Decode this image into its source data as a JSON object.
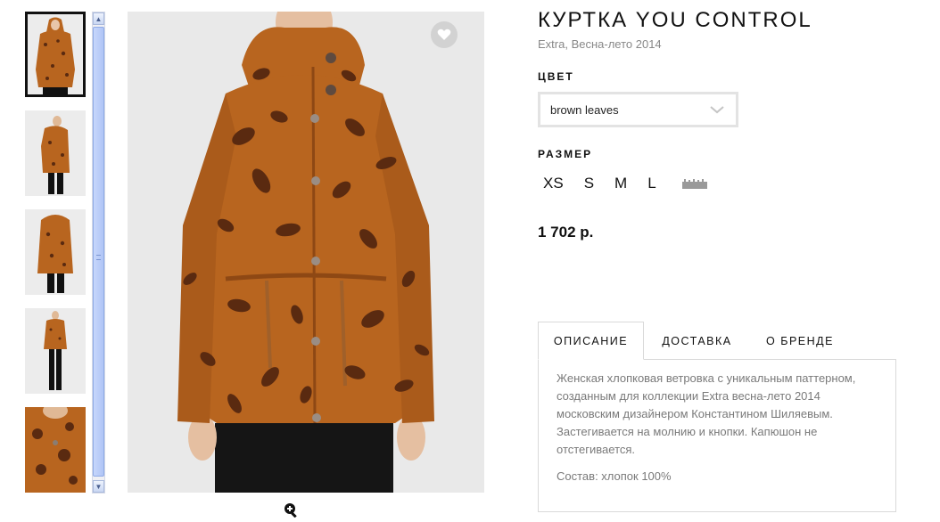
{
  "product": {
    "title": "КУРТКА YOU CONTROL",
    "subtitle": "Extra, Весна-лето 2014",
    "color_label": "ЦВЕТ",
    "color_value": "brown leaves",
    "size_label": "РАЗМЕР",
    "sizes": [
      "XS",
      "S",
      "M",
      "L"
    ],
    "price": "1 702 р."
  },
  "tabs": [
    {
      "label": "ОПИСАНИЕ",
      "active": true
    },
    {
      "label": "ДОСТАВКА",
      "active": false
    },
    {
      "label": "О БРЕНДЕ",
      "active": false
    }
  ],
  "description": {
    "text": "Женская хлопковая ветровка с уникальным паттерном, созданным для коллекции Extra весна-лето 2014 московским дизайнером Константином Шиляевым. Застегивается на молнию и кнопки. Капюшон не отстегивается.",
    "composition": "Состав: хлопок 100%"
  },
  "gallery": {
    "thumbnail_count": 5,
    "active_thumbnail": 0
  },
  "icons": {
    "favorite": "heart-icon",
    "zoom": "zoom-in-icon",
    "size_guide": "ruler-icon",
    "dropdown": "chevron-down-icon"
  },
  "colors": {
    "jacket": "#b8651f",
    "leaf_print": "#5a2a10",
    "image_bg": "#e9e9e9",
    "border": "#d9d9d9",
    "muted_text": "#7a7a7a"
  }
}
